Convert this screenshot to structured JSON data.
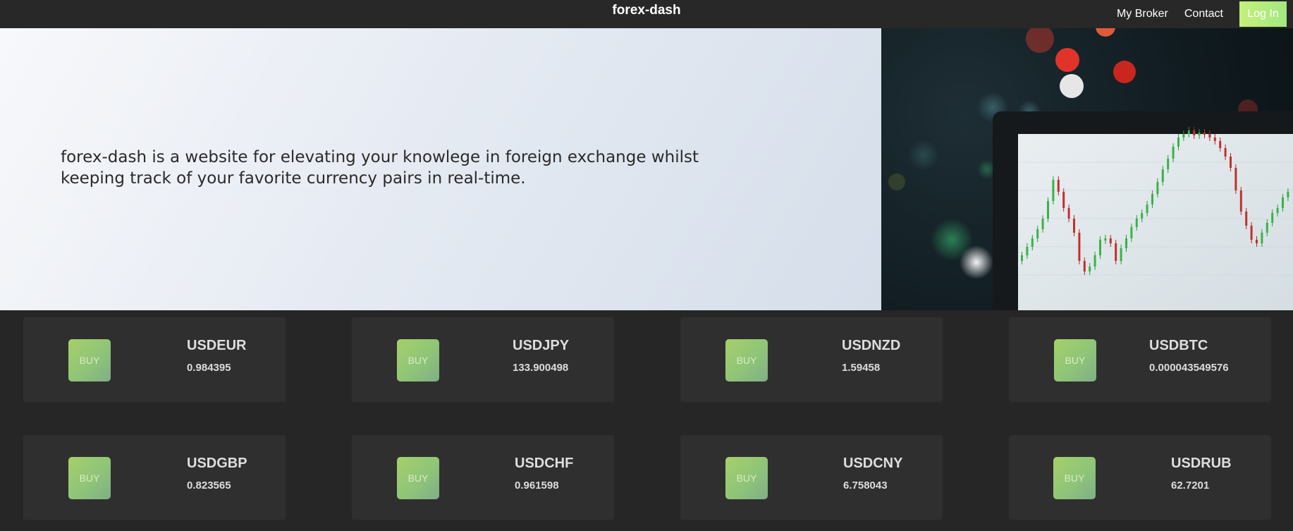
{
  "header": {
    "brand": "forex-dash",
    "nav": {
      "broker": "My Broker",
      "contact": "Contact",
      "login": "Log In"
    },
    "accent": "#b8ec7e"
  },
  "hero": {
    "text": "forex-dash is a website for elevating your knowlege in foreign exchange whilst keeping track of your favorite currency pairs in real-time."
  },
  "cards": [
    {
      "buy": "BUY",
      "pair": "USDEUR",
      "rate": "0.984395"
    },
    {
      "buy": "BUY",
      "pair": "USDJPY",
      "rate": "133.900498"
    },
    {
      "buy": "BUY",
      "pair": "USDNZD",
      "rate": "1.59458"
    },
    {
      "buy": "BUY",
      "pair": "USDBTC",
      "rate": "0.000043549576"
    },
    {
      "buy": "BUY",
      "pair": "USDGBP",
      "rate": "0.823565"
    },
    {
      "buy": "BUY",
      "pair": "USDCHF",
      "rate": "0.961598"
    },
    {
      "buy": "BUY",
      "pair": "USDCNY",
      "rate": "6.758043"
    },
    {
      "buy": "BUY",
      "pair": "USDRUB",
      "rate": "62.7201"
    }
  ]
}
